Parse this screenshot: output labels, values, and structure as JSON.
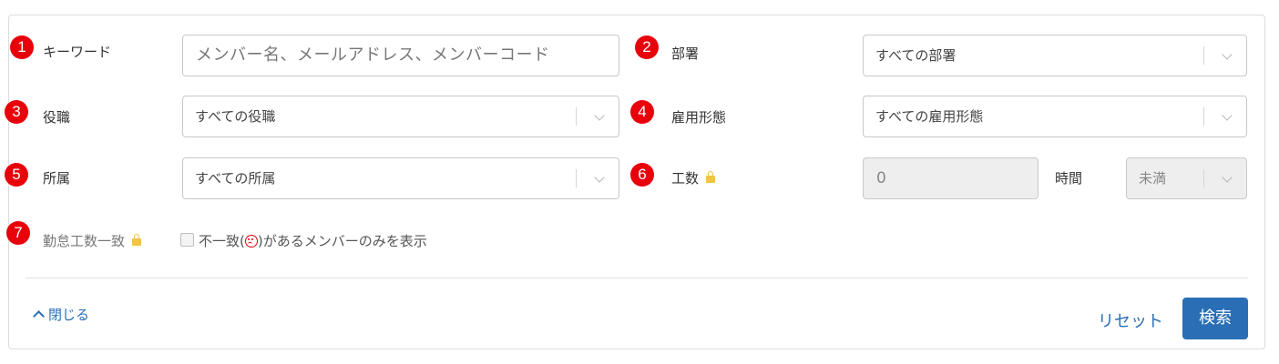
{
  "badges": [
    "1",
    "2",
    "3",
    "4",
    "5",
    "6",
    "7"
  ],
  "filters": {
    "keyword": {
      "label": "キーワード",
      "placeholder": "メンバー名、メールアドレス、メンバーコード"
    },
    "department": {
      "label": "部署",
      "selected": "すべての部署"
    },
    "position": {
      "label": "役職",
      "selected": "すべての役職"
    },
    "employment_type": {
      "label": "雇用形態",
      "selected": "すべての雇用形態"
    },
    "affiliation": {
      "label": "所属",
      "selected": "すべての所属"
    },
    "man_hours": {
      "label": "工数",
      "locked": true,
      "value": "0",
      "unit": "時間",
      "comparison": "未満"
    },
    "attendance_match": {
      "label": "勤怠工数一致",
      "locked": true,
      "checkbox_prefix": "不一致(",
      "checkbox_suffix": ")があるメンバーのみを表示",
      "icon": "frown-icon",
      "checked": false
    }
  },
  "footer": {
    "close_label": "閉じる",
    "reset_label": "リセット",
    "search_label": "検索"
  },
  "colors": {
    "badge": "#e8000b",
    "link": "#2a6fb5",
    "primary_button": "#2a6fb5",
    "lock": "#f2c24a",
    "border": "#c8c8c8"
  }
}
